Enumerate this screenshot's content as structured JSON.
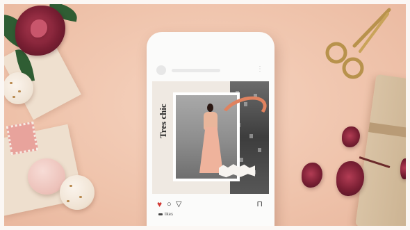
{
  "scene": {
    "post_caption_text": "Tres chic",
    "icons": [
      "heart-icon",
      "comment-icon",
      "share-icon",
      "bookmark-icon"
    ],
    "likes_label": "likes",
    "colors": {
      "background": "#f2c9b3",
      "phone": "#fbfbfa",
      "accent_stroke": "#e0825f",
      "like_red": "#d23a35",
      "flower": "#7a1f33"
    }
  }
}
